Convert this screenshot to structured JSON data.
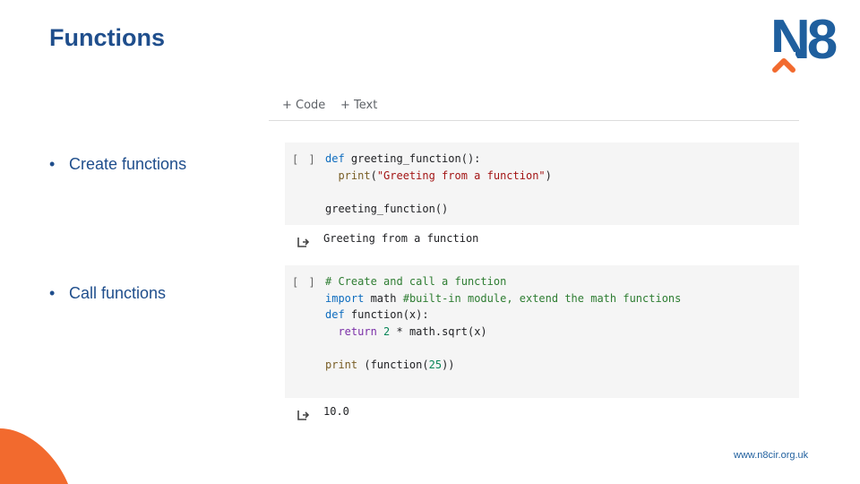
{
  "slide": {
    "title": "Functions",
    "logo_text": "N8",
    "footer_url": "www.n8cir.org.uk"
  },
  "bullets": [
    "Create functions",
    "Call functions"
  ],
  "toolbar": {
    "code_label": "+ Code",
    "text_label": "+ Text"
  },
  "cells": [
    {
      "run_label": "[ ]",
      "code_lines": [
        "def greeting_function():",
        "  print(\"Greeting from a function\")",
        "",
        "greeting_function()"
      ],
      "output": "Greeting from a function"
    },
    {
      "run_label": "[ ]",
      "code_lines": [
        "# Create and call a function",
        "import math #built-in module, extend the math functions",
        "def function(x):",
        "  return 2 * math.sqrt(x)",
        "",
        "print (function(25))"
      ],
      "output": "10.0"
    }
  ],
  "colors": {
    "title": "#1f4e8c",
    "logo_blue": "#1f5f9e",
    "logo_orange": "#f26a2e",
    "cell_bg": "#f5f5f5"
  },
  "icons": [
    "output-arrow-icon",
    "logo-chevron-icon",
    "corner-swoosh"
  ]
}
